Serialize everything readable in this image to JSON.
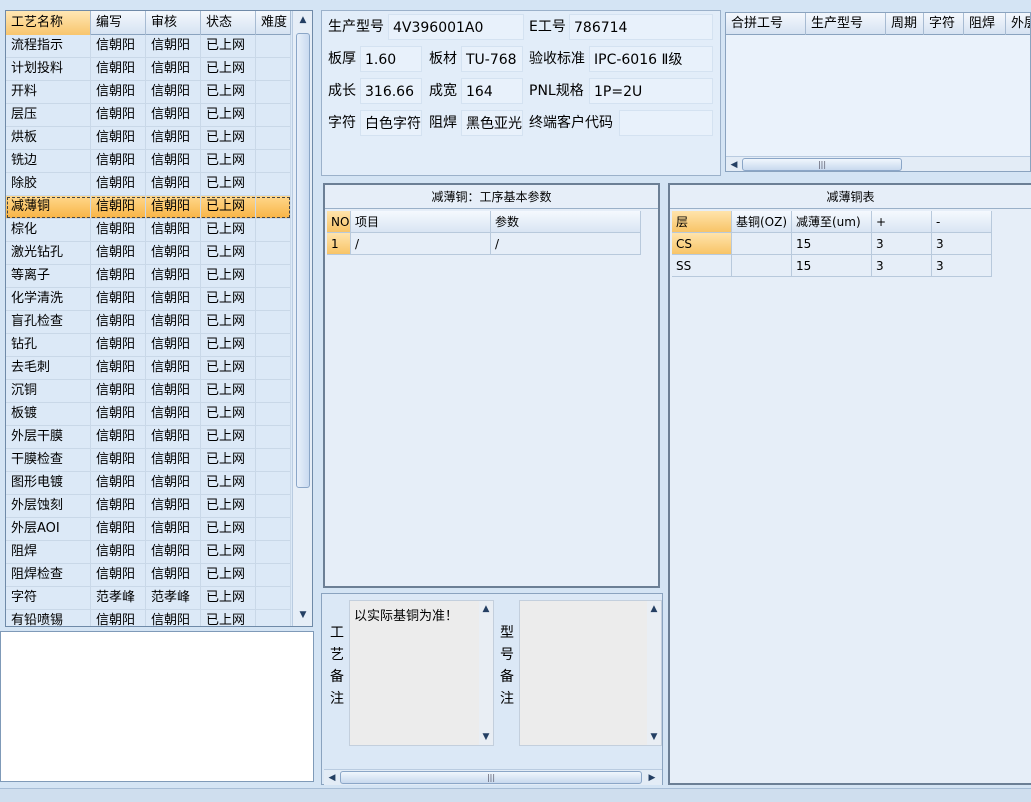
{
  "process_grid": {
    "headers": [
      "工艺名称",
      "编写",
      "审核",
      "状态",
      "难度"
    ],
    "rows": [
      [
        "流程指示",
        "信朝阳",
        "信朝阳",
        "已上网",
        ""
      ],
      [
        "计划投料",
        "信朝阳",
        "信朝阳",
        "已上网",
        ""
      ],
      [
        "开料",
        "信朝阳",
        "信朝阳",
        "已上网",
        ""
      ],
      [
        "层压",
        "信朝阳",
        "信朝阳",
        "已上网",
        ""
      ],
      [
        "烘板",
        "信朝阳",
        "信朝阳",
        "已上网",
        ""
      ],
      [
        "铣边",
        "信朝阳",
        "信朝阳",
        "已上网",
        ""
      ],
      [
        "除胶",
        "信朝阳",
        "信朝阳",
        "已上网",
        ""
      ],
      [
        "减薄铜",
        "信朝阳",
        "信朝阳",
        "已上网",
        ""
      ],
      [
        "棕化",
        "信朝阳",
        "信朝阳",
        "已上网",
        ""
      ],
      [
        "激光钻孔",
        "信朝阳",
        "信朝阳",
        "已上网",
        ""
      ],
      [
        "等离子",
        "信朝阳",
        "信朝阳",
        "已上网",
        ""
      ],
      [
        "化学清洗",
        "信朝阳",
        "信朝阳",
        "已上网",
        ""
      ],
      [
        "盲孔检查",
        "信朝阳",
        "信朝阳",
        "已上网",
        ""
      ],
      [
        "钻孔",
        "信朝阳",
        "信朝阳",
        "已上网",
        ""
      ],
      [
        "去毛刺",
        "信朝阳",
        "信朝阳",
        "已上网",
        ""
      ],
      [
        "沉铜",
        "信朝阳",
        "信朝阳",
        "已上网",
        ""
      ],
      [
        "板镀",
        "信朝阳",
        "信朝阳",
        "已上网",
        ""
      ],
      [
        "外层干膜",
        "信朝阳",
        "信朝阳",
        "已上网",
        ""
      ],
      [
        "干膜检查",
        "信朝阳",
        "信朝阳",
        "已上网",
        ""
      ],
      [
        "图形电镀",
        "信朝阳",
        "信朝阳",
        "已上网",
        ""
      ],
      [
        "外层蚀刻",
        "信朝阳",
        "信朝阳",
        "已上网",
        ""
      ],
      [
        "外层AOI",
        "信朝阳",
        "信朝阳",
        "已上网",
        ""
      ],
      [
        "阻焊",
        "信朝阳",
        "信朝阳",
        "已上网",
        ""
      ],
      [
        "阻焊检查",
        "信朝阳",
        "信朝阳",
        "已上网",
        ""
      ],
      [
        "字符",
        "范孝峰",
        "范孝峰",
        "已上网",
        ""
      ],
      [
        "有铅喷锡",
        "信朝阳",
        "信朝阳",
        "已上网",
        ""
      ]
    ],
    "selected_row": "减薄铜"
  },
  "info": {
    "model_label": "生产型号",
    "model_value": "4V396001A0",
    "eno_label": "E工号",
    "eno_value": "786714",
    "thickness_label": "板厚",
    "thickness_value": "1.60",
    "material_label": "板材",
    "material_value": "TU-768",
    "standard_label": "验收标准",
    "standard_value": "IPC-6016 Ⅱ级",
    "length_label": "成长",
    "length_value": "316.66",
    "width_label": "成宽",
    "width_value": "164",
    "pnl_label": "PNL规格",
    "pnl_value": "1P=2U",
    "char_label": "字符",
    "char_value": "白色字符",
    "mask_label": "阻焊",
    "mask_value": "黑色亚光",
    "customer_label": "终端客户代码",
    "customer_value": ""
  },
  "combine_grid": {
    "headers": [
      "合拼工号",
      "生产型号",
      "周期",
      "字符",
      "阻焊",
      "外层"
    ]
  },
  "params_panel": {
    "title": "减薄铜：工序基本参数",
    "headers": [
      "NO",
      "项目",
      "参数"
    ],
    "rows": [
      [
        "1",
        "/",
        "/"
      ]
    ]
  },
  "thin_copper": {
    "title": "减薄铜表",
    "headers": [
      "层",
      "基铜(OZ)",
      "减薄至(um)",
      "+",
      "-"
    ],
    "rows": [
      [
        "CS",
        "",
        "15",
        "3",
        "3"
      ],
      [
        "SS",
        "",
        "15",
        "3",
        "3"
      ]
    ]
  },
  "remarks": {
    "process_label": "工艺备注",
    "process_text": "以实际基铜为准！",
    "model_label": "型号备注",
    "model_text": ""
  },
  "icons": {
    "scroll_up": "chevron-up-icon",
    "scroll_down": "chevron-down-icon",
    "scroll_left": "chevron-left-icon",
    "scroll_right": "chevron-right-icon"
  }
}
